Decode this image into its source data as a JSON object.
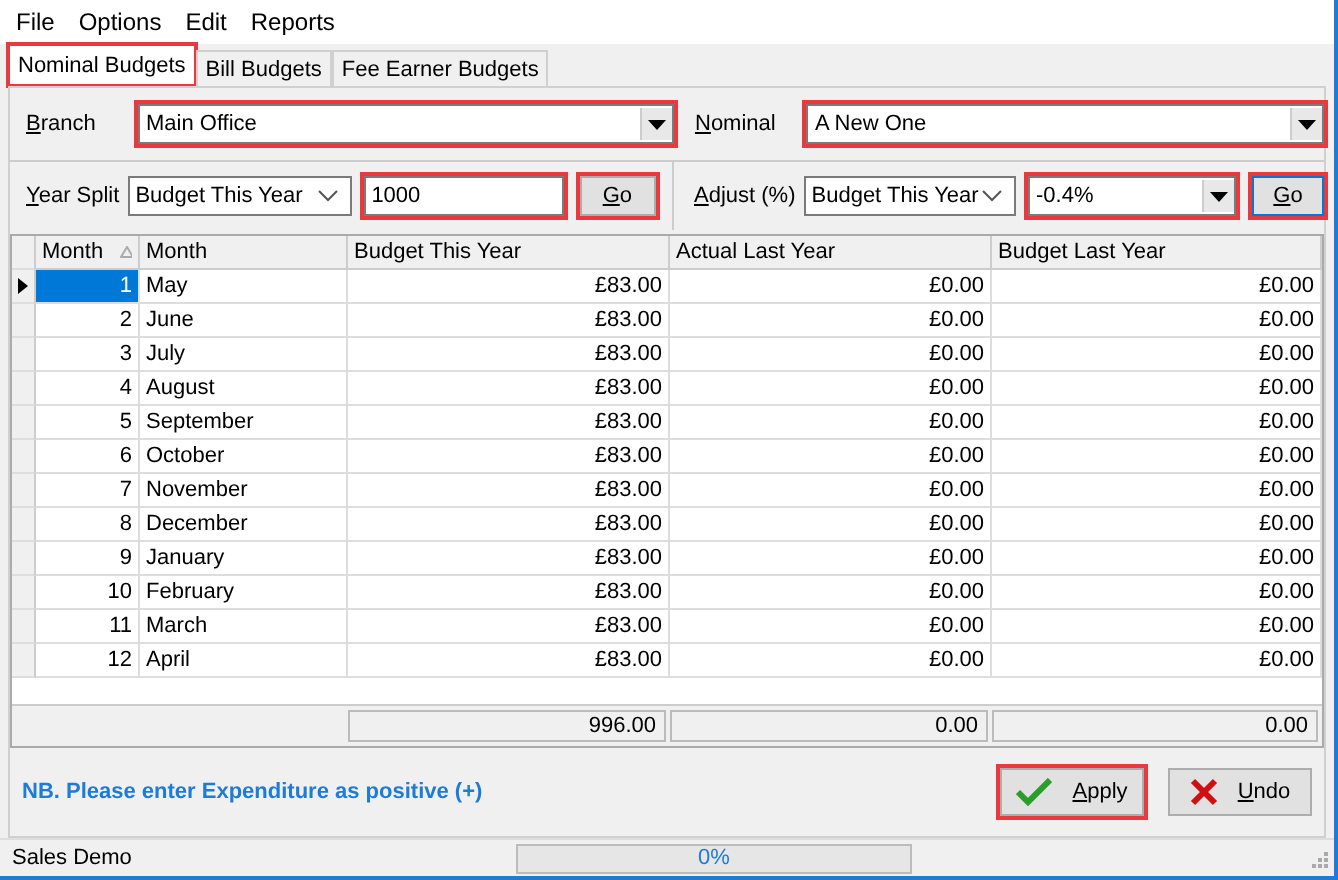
{
  "menu": [
    {
      "label": "File"
    },
    {
      "label": "Options"
    },
    {
      "label": "Edit"
    },
    {
      "label": "Reports"
    }
  ],
  "tabs": [
    {
      "label": "Nominal Budgets",
      "selected": true,
      "highlighted": true
    },
    {
      "label": "Bill Budgets",
      "selected": false,
      "highlighted": false
    },
    {
      "label": "Fee Earner Budgets",
      "selected": false,
      "highlighted": false
    }
  ],
  "branch": {
    "label": "Branch",
    "value": "Main Office",
    "highlighted": true
  },
  "nominal": {
    "label": "Nominal",
    "value": "A New One",
    "highlighted": true
  },
  "year_split": {
    "label": "Year Split",
    "mode": {
      "value": "Budget This Year",
      "highlighted": false
    },
    "amount": {
      "value": "1000",
      "highlighted": true
    },
    "go": {
      "label": "Go",
      "highlighted": true
    }
  },
  "adjust": {
    "label": "Adjust (%)",
    "mode": {
      "value": "Budget This Year",
      "highlighted": false
    },
    "percent": {
      "value": "-0.4%",
      "highlighted": true
    },
    "go": {
      "label": "Go",
      "highlighted": true
    }
  },
  "table": {
    "columns": [
      {
        "label": "Month",
        "sorted": true
      },
      {
        "label": "Month",
        "sorted": false
      },
      {
        "label": "Budget This Year",
        "sorted": false
      },
      {
        "label": "Actual Last Year",
        "sorted": false
      },
      {
        "label": "Budget Last Year",
        "sorted": false
      }
    ],
    "rows": [
      {
        "cells": [
          "1",
          "May",
          "£83.00",
          "£0.00",
          "£0.00"
        ],
        "selected": true
      },
      {
        "cells": [
          "2",
          "June",
          "£83.00",
          "£0.00",
          "£0.00"
        ],
        "selected": false
      },
      {
        "cells": [
          "3",
          "July",
          "£83.00",
          "£0.00",
          "£0.00"
        ],
        "selected": false
      },
      {
        "cells": [
          "4",
          "August",
          "£83.00",
          "£0.00",
          "£0.00"
        ],
        "selected": false
      },
      {
        "cells": [
          "5",
          "September",
          "£83.00",
          "£0.00",
          "£0.00"
        ],
        "selected": false
      },
      {
        "cells": [
          "6",
          "October",
          "£83.00",
          "£0.00",
          "£0.00"
        ],
        "selected": false
      },
      {
        "cells": [
          "7",
          "November",
          "£83.00",
          "£0.00",
          "£0.00"
        ],
        "selected": false
      },
      {
        "cells": [
          "8",
          "December",
          "£83.00",
          "£0.00",
          "£0.00"
        ],
        "selected": false
      },
      {
        "cells": [
          "9",
          "January",
          "£83.00",
          "£0.00",
          "£0.00"
        ],
        "selected": false
      },
      {
        "cells": [
          "10",
          "February",
          "£83.00",
          "£0.00",
          "£0.00"
        ],
        "selected": false
      },
      {
        "cells": [
          "11",
          "March",
          "£83.00",
          "£0.00",
          "£0.00"
        ],
        "selected": false
      },
      {
        "cells": [
          "12",
          "April",
          "£83.00",
          "£0.00",
          "£0.00"
        ],
        "selected": false
      }
    ],
    "totals": [
      "996.00",
      "0.00",
      "0.00"
    ]
  },
  "note": "NB. Please enter Expenditure as positive (+)",
  "buttons": [
    {
      "label": "Apply",
      "kind": "apply",
      "highlighted": true
    },
    {
      "label": "Undo",
      "kind": "undo",
      "highlighted": false
    }
  ],
  "status_bar": {
    "text": "Sales Demo",
    "progress": {
      "label": "0%",
      "level": 0
    }
  }
}
